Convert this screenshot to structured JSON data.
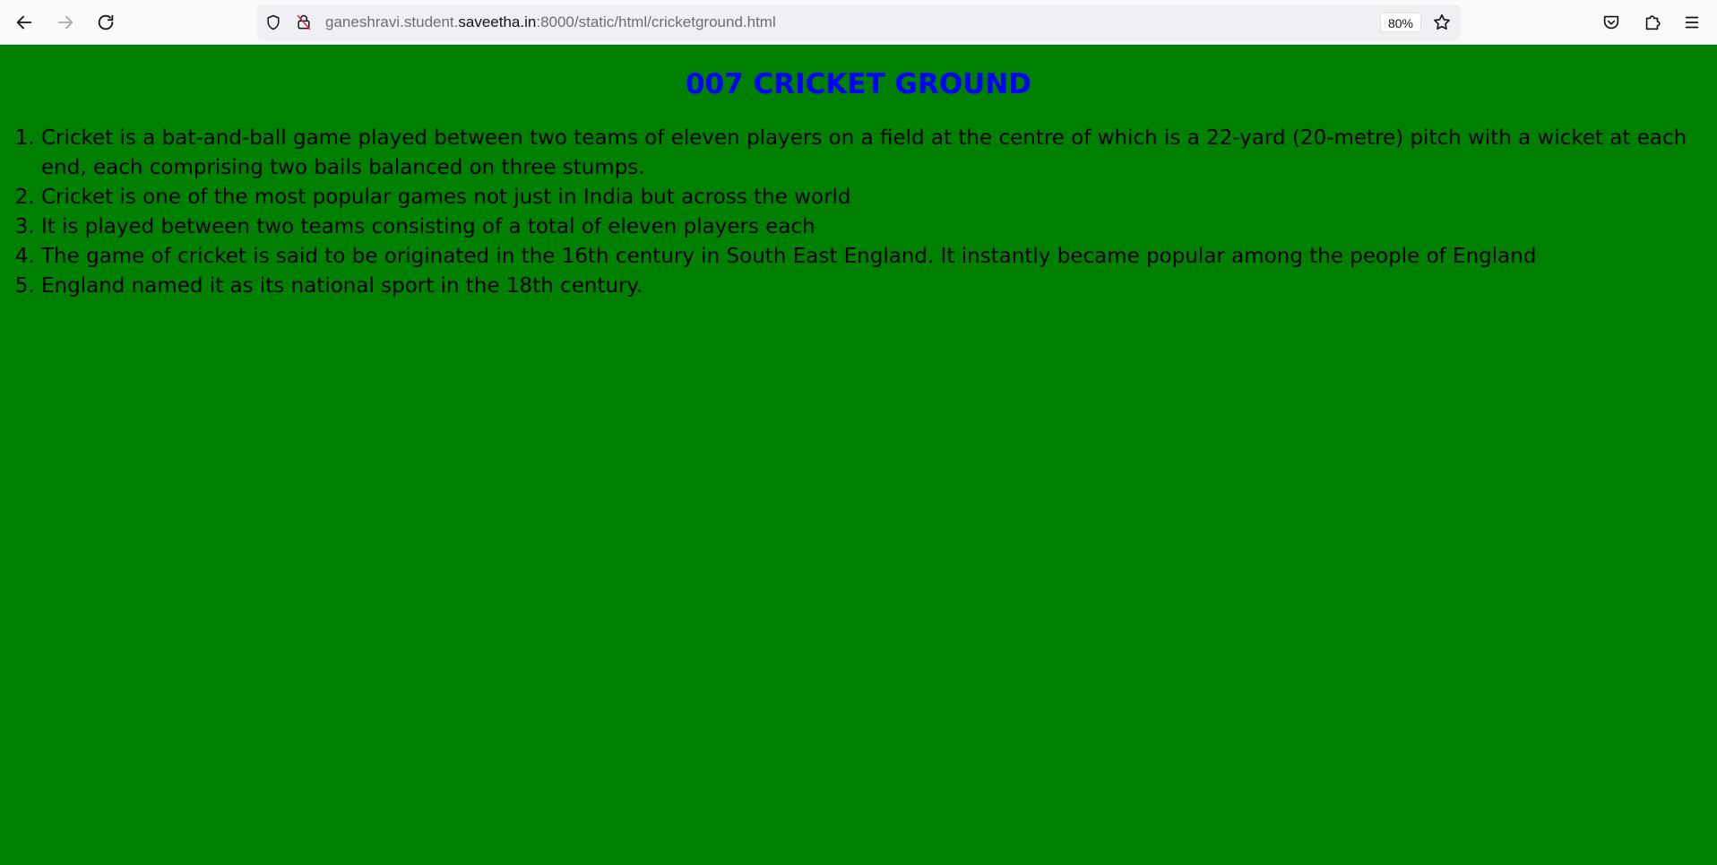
{
  "browser": {
    "url_prefix": "ganeshravi.student.",
    "url_domain": "saveetha.in",
    "url_suffix": ":8000/static/html/cricketground.html",
    "zoom": "80%",
    "icons": {
      "back": "arrow-left-icon",
      "forward": "arrow-right-icon",
      "reload": "reload-icon",
      "shield": "shield-icon",
      "insecure": "insecure-lock-icon",
      "bookmark": "star-icon",
      "pocket": "pocket-icon",
      "extensions": "puzzle-icon",
      "menu": "hamburger-menu-icon"
    }
  },
  "page": {
    "background_color": "#008000",
    "title": "007 CRICKET GROUND",
    "title_color": "#0000ff",
    "items": [
      "Cricket is a bat-and-ball game played between two teams of eleven players on a field at the centre of which is a 22-yard (20-metre) pitch with a wicket at each end, each comprising two bails balanced on three stumps.",
      "Cricket is one of the most popular games not just in India but across the world",
      "It is played between two teams consisting of a total of eleven players each",
      "The game of cricket is said to be originated in the 16th century in South East England. It instantly became popular among the people of England",
      "England named it as its national sport in the 18th century."
    ]
  }
}
